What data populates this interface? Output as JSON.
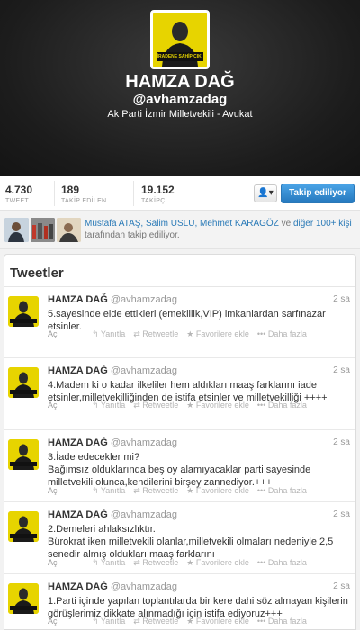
{
  "profile": {
    "name": "HAMZA DAĞ",
    "handle": "@avhamzadag",
    "bio": "Ak Parti İzmir Milletvekili - Avukat",
    "avatar_banner_text": "İRADENE SAHİP ÇIK!",
    "accent_color": "#e7d400"
  },
  "stats": [
    {
      "value": "4.730",
      "label": "TWEET"
    },
    {
      "value": "189",
      "label": "TAKİP EDİLEN"
    },
    {
      "value": "19.152",
      "label": "TAKİPÇİ"
    }
  ],
  "actions": {
    "settings_icon": "person-dropdown-icon",
    "settings_label": "👤▾",
    "follow_label": "Takip ediliyor"
  },
  "followed_by": {
    "names": "Mustafa ATAŞ, Salim USLU, Mehmet KARAGÖZ",
    "connector": "ve",
    "more": "diğer 100+ kişi",
    "suffix": "tarafından takip ediliyor."
  },
  "tweets_title": "Tweetler",
  "tweet_actions": {
    "open": "Aç",
    "reply": "↰ Yanıtla",
    "retweet": "⇄ Retweetle",
    "favorite": "★ Favorilere ekle",
    "more": "••• Daha fazla"
  },
  "tweets": [
    {
      "name": "HAMZA DAĞ",
      "handle": "@avhamzadag",
      "time": "2 sa",
      "text": "5.sayesinde elde ettikleri (emeklilik,VIP) imkanlardan sarfınazar etsinler."
    },
    {
      "name": "HAMZA DAĞ",
      "handle": "@avhamzadag",
      "time": "2 sa",
      "text": "4.Madem ki o kadar ilkeliler hem aldıkları maaş farklarını iade etsinler,milletvekilliğinden de istifa etsinler ve milletvekilliği ++++"
    },
    {
      "name": "HAMZA DAĞ",
      "handle": "@avhamzadag",
      "time": "2 sa",
      "text": "3.İade edecekler mi?\nBağımsız olduklarında beş oy alamıyacaklar parti sayesinde milletvekili olunca,kendilerini birşey zannediyor.+++"
    },
    {
      "name": "HAMZA DAĞ",
      "handle": "@avhamzadag",
      "time": "2 sa",
      "text": "2.Demeleri ahlaksızlıktır.\nBürokrat iken milletvekili olanlar,milletvekili olmaları nedeniyle 2,5 senedir almış oldukları maaş farklarını"
    },
    {
      "name": "HAMZA DAĞ",
      "handle": "@avhamzadag",
      "time": "2 sa",
      "text": "1.Parti içinde yapılan toplantılarda bir kere dahi söz almayan kişilerin görüşlerimiz dikkate alınmadığı için istifa ediyoruz+++"
    }
  ]
}
